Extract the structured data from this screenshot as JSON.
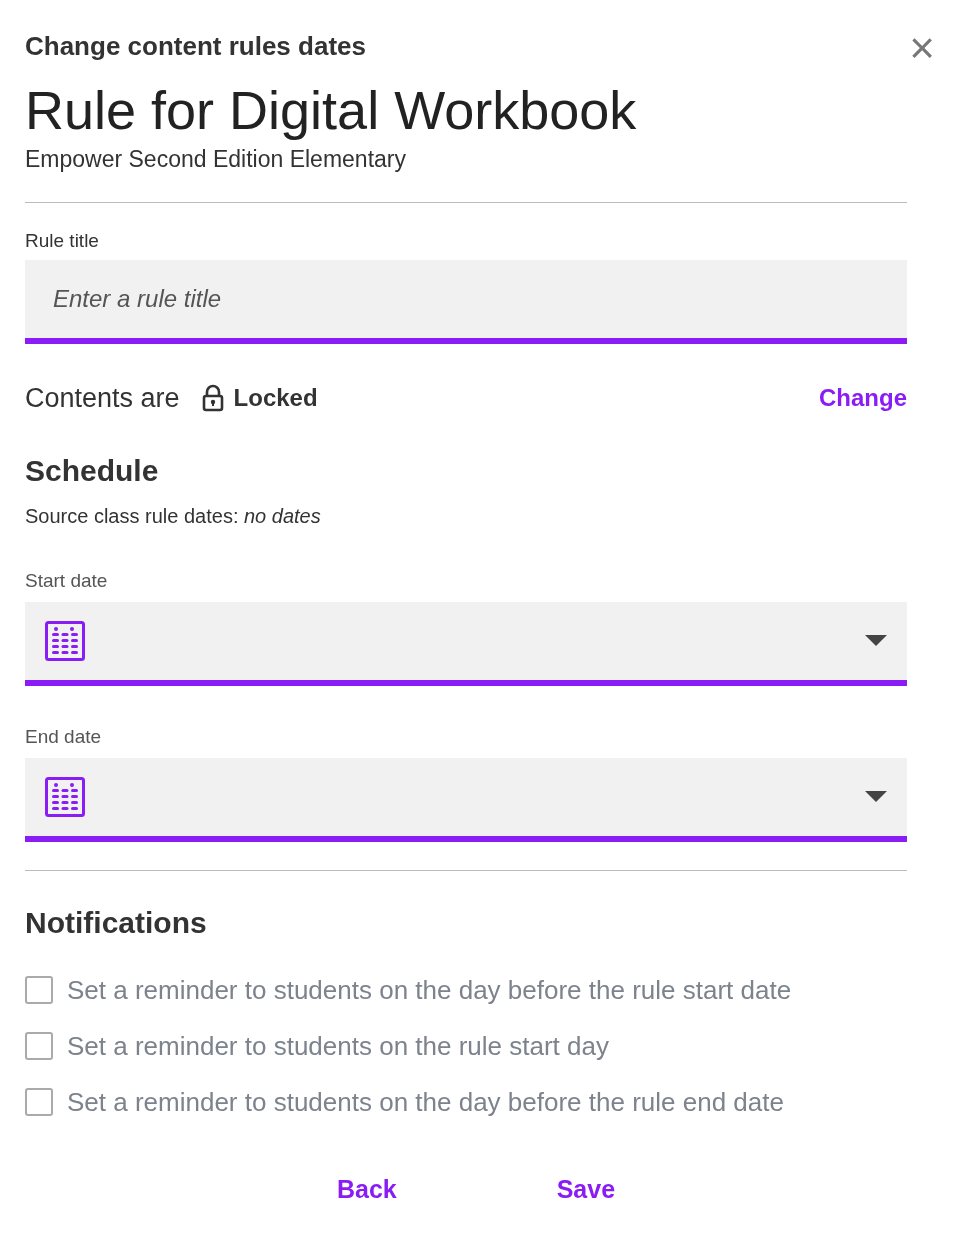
{
  "dialog": {
    "heading": "Change content rules dates",
    "close_icon": "×"
  },
  "title": "Rule for Digital Workbook",
  "subtitle": "Empower Second Edition Elementary",
  "rule_title": {
    "label": "Rule title",
    "placeholder": "Enter a rule title"
  },
  "contents": {
    "label": "Contents are",
    "state": "Locked",
    "locked": true,
    "change_link": "Change"
  },
  "schedule": {
    "heading": "Schedule",
    "source_note": "Source class rule dates: *no dates*",
    "fields": [
      {
        "label": "Start date"
      },
      {
        "label": "End date"
      }
    ]
  },
  "notifications": {
    "heading": "Notifications",
    "options": [
      {
        "label": "Set a reminder to students on the day before the rule start date",
        "checked": false
      },
      {
        "label": "Set a reminder to students on the rule start day",
        "checked": false
      },
      {
        "label": "Set a reminder to students on the day before the rule end date",
        "checked": false
      }
    ]
  },
  "buttons": [
    "Back",
    "Save"
  ]
}
